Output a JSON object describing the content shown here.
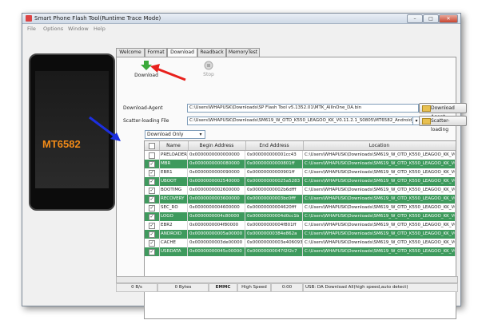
{
  "window": {
    "title": "Smart Phone Flash Tool(Runtime Trace Mode)",
    "controls": [
      "–",
      "□",
      "✕"
    ]
  },
  "menu": [
    "File",
    "Options",
    "Window",
    "Help"
  ],
  "phone": {
    "chip_label": "MT6582"
  },
  "tabs": [
    {
      "label": "Welcome",
      "active": false
    },
    {
      "label": "Format",
      "active": false
    },
    {
      "label": "Download",
      "active": true
    },
    {
      "label": "Readback",
      "active": false
    },
    {
      "label": "MemoryTest",
      "active": false
    }
  ],
  "toolbar": {
    "download_label": "Download",
    "stop_label": "Stop"
  },
  "download_agent": {
    "label": "Download-Agent",
    "value": "C:\\Users\\WHAPUSK\\Downloads\\SP Flash Tool v5.1352.01\\MTK_AllInOne_DA.bin",
    "button": "Download Agent"
  },
  "scatter": {
    "label": "Scatter-loading File",
    "value": "C:\\Users\\WHAPUSK\\Downloads\\SM619_W_OTD_K550_LEAGOO_KK_V0.11.2.1_S0805\\MT6582_Android_scat",
    "button": "Scatter-loading"
  },
  "mode_select": {
    "value": "Download Only"
  },
  "table": {
    "headers": [
      "",
      "Name",
      "Begin Address",
      "End Address",
      "Location"
    ],
    "rows": [
      {
        "checked": false,
        "name": "PRELOADER",
        "begin": "0x0000000000000000",
        "end": "0x000000000001cc43",
        "location": "C:\\Users\\WHAPUSK\\Downloads\\SM619_W_OTD_K550_LEAGOO_KK_V0.11...",
        "green": false
      },
      {
        "checked": true,
        "name": "MBR",
        "begin": "0x0000000000080000",
        "end": "0x00000000000801ff",
        "location": "C:\\Users\\WHAPUSK\\Downloads\\SM619_W_OTD_K550_LEAGOO_KK_V0.11...",
        "green": true
      },
      {
        "checked": true,
        "name": "EBR1",
        "begin": "0x0000000000090000",
        "end": "0x00000000000901ff",
        "location": "C:\\Users\\WHAPUSK\\Downloads\\SM619_W_OTD_K550_LEAGOO_KK_V0.11...",
        "green": false
      },
      {
        "checked": true,
        "name": "UBOOT",
        "begin": "0x0000000002540000",
        "end": "0x000000000025a5283",
        "location": "C:\\Users\\WHAPUSK\\Downloads\\SM619_W_OTD_K550_LEAGOO_KK_V0.11...",
        "green": true
      },
      {
        "checked": true,
        "name": "BOOTIMG",
        "begin": "0x0000000002600000",
        "end": "0x00000000002b6dfff",
        "location": "C:\\Users\\WHAPUSK\\Downloads\\SM619_W_OTD_K550_LEAGOO_KK_V0.11...",
        "green": false
      },
      {
        "checked": true,
        "name": "RECOVERY",
        "begin": "0x0000000003600000",
        "end": "0x00000000003bc0fff",
        "location": "C:\\Users\\WHAPUSK\\Downloads\\SM619_W_OTD_K550_LEAGOO_KK_V0.11...",
        "green": true
      },
      {
        "checked": true,
        "name": "SEC_RO",
        "begin": "0x0000000004600000",
        "end": "0x00000000004620fff",
        "location": "C:\\Users\\WHAPUSK\\Downloads\\SM619_W_OTD_K550_LEAGOO_KK_V0.11...",
        "green": false
      },
      {
        "checked": true,
        "name": "LOGO",
        "begin": "0x0000000004c80000",
        "end": "0x00000000004d0cc1b",
        "location": "C:\\Users\\WHAPUSK\\Downloads\\SM619_W_OTD_K550_LEAGOO_KK_V0.11...",
        "green": true
      },
      {
        "checked": true,
        "name": "EBR2",
        "begin": "0x0000000004f80000",
        "end": "0x00000000004f801ff",
        "location": "C:\\Users\\WHAPUSK\\Downloads\\SM619_W_OTD_K550_LEAGOO_KK_V0.11...",
        "green": false
      },
      {
        "checked": true,
        "name": "ANDROID",
        "begin": "0x00000000005a00000",
        "end": "0x00000000384e862a",
        "location": "C:\\Users\\WHAPUSK\\Downloads\\SM619_W_OTD_K550_LEAGOO_KK_V0.11...",
        "green": true
      },
      {
        "checked": true,
        "name": "CACHE",
        "begin": "0x0000000003de00000",
        "end": "0x00000000003e406093",
        "location": "C:\\Users\\WHAPUSK\\Downloads\\SM619_W_OTD_K550_LEAGOO_KK_V0.11...",
        "green": false
      },
      {
        "checked": true,
        "name": "USRDATA",
        "begin": "0x00000000045c00000",
        "end": "0x00000000047f2f2c7",
        "location": "C:\\Users\\WHAPUSK\\Downloads\\SM619_W_OTD_K550_LEAGOO_KK_V0.11...",
        "green": true
      }
    ]
  },
  "status": {
    "speed": "0 B/s",
    "bytes": "0 Bytes",
    "storage": "EMMC",
    "mode": "High Speed",
    "time": "0:00",
    "message": "USB: DA Download All(high speed,auto detect)"
  },
  "progress": 0,
  "colors": {
    "row_green": "#3e9a5d",
    "row_white": "#ffffff",
    "accent_red": "#e8201c",
    "accent_blue": "#1c2fe0",
    "chip": "#f08a18"
  },
  "icons": {
    "download": "green-down-arrow-icon",
    "stop": "stop-circle-icon",
    "folder": "folder-icon"
  }
}
